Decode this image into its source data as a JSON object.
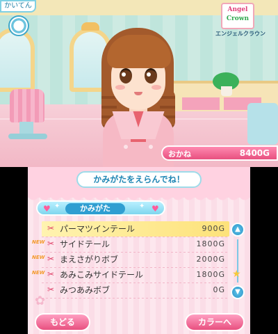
{
  "top": {
    "mode_tag": "かいてん",
    "logo": {
      "line1": "Angel",
      "line2": "Crown",
      "subtitle": "エンジェルクラウン"
    },
    "money": {
      "label": "おかね",
      "value": "8400G"
    }
  },
  "bottom": {
    "header": "かみがたをえらんでね！",
    "category": "かみがた",
    "items": [
      {
        "name": "パーマツインテール",
        "price": "900G",
        "is_new": false,
        "selected": true
      },
      {
        "name": "サイドテール",
        "price": "1800G",
        "is_new": true,
        "selected": false
      },
      {
        "name": "まえさがりボブ",
        "price": "2000G",
        "is_new": true,
        "selected": false
      },
      {
        "name": "あみこみサイドテール",
        "price": "1800G",
        "is_new": true,
        "selected": false
      },
      {
        "name": "みつあみボブ",
        "price": "0G",
        "is_new": false,
        "selected": false
      }
    ],
    "new_badge": "NEW",
    "back_button": "もどる",
    "next_button": "カラーへ"
  },
  "colors": {
    "accent_pink": "#e8507f",
    "accent_blue": "#2f9ed1",
    "selected_row": "#fde27a"
  },
  "icons": {
    "row_icon": "scissors-icon",
    "scroll_up": "arrow-up-icon",
    "scroll_down": "arrow-down-icon"
  }
}
